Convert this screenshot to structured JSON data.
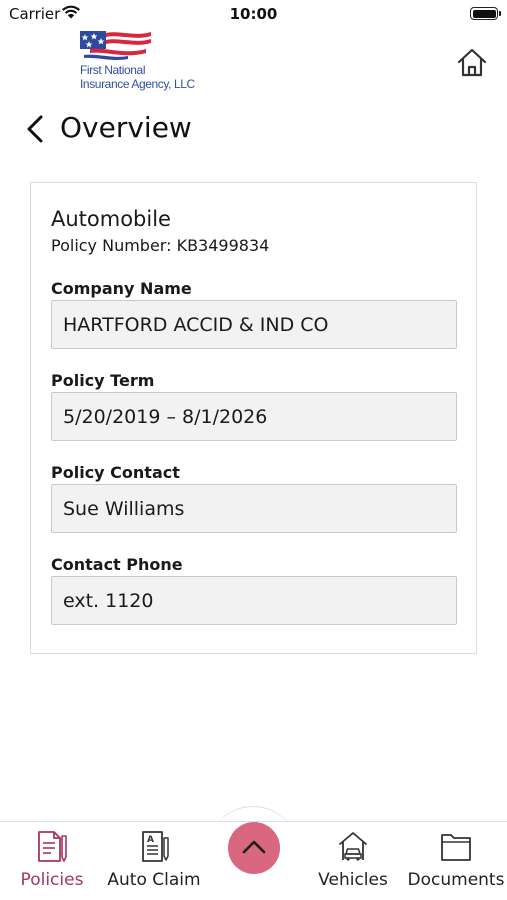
{
  "status_bar": {
    "carrier": "Carrier",
    "time": "10:00",
    "icons": [
      "wifi-icon",
      "battery-icon"
    ]
  },
  "header": {
    "logo_line1": "First National",
    "logo_line2": "Insurance Agency, LLC",
    "home_icon": "home-icon"
  },
  "nav": {
    "back_icon": "chevron-left-icon",
    "title": "Overview"
  },
  "policy": {
    "type": "Automobile",
    "number_text": "Policy Number: KB3499834",
    "fields": [
      {
        "label": "Company Name",
        "value": "HARTFORD ACCID & IND CO"
      },
      {
        "label": "Policy Term",
        "value": "5/20/2019 – 8/1/2026"
      },
      {
        "label": "Policy Contact",
        "value": "Sue Williams"
      },
      {
        "label": "Contact Phone",
        "value": "ext. 1120"
      }
    ]
  },
  "tab_bar": {
    "active_color": "#a8365a",
    "fab_color": "#d9677f",
    "tabs": [
      {
        "label": "Policies",
        "icon": "policy-document-icon",
        "active": true
      },
      {
        "label": "Auto Claim",
        "icon": "claim-form-icon",
        "active": false
      },
      {
        "label": "Vehicles",
        "icon": "car-garage-icon",
        "active": false
      },
      {
        "label": "Documents",
        "icon": "folder-icon",
        "active": false
      }
    ],
    "fab_icon": "chevron-up-icon"
  }
}
